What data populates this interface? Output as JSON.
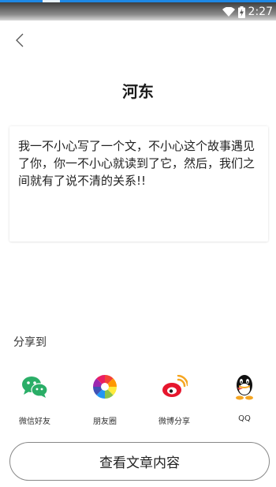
{
  "status_bar": {
    "time": "2:27"
  },
  "header": {
    "title": "河东"
  },
  "content": {
    "text": "我一不小心写了一个文，不小心这个故事遇见了你，你一不小心就读到了它，然后，我们之间就有了说不清的关系!!"
  },
  "share": {
    "label": "分享到",
    "items": [
      {
        "label": "微信好友",
        "icon": "wechat-icon"
      },
      {
        "label": "朋友圈",
        "icon": "moments-icon"
      },
      {
        "label": "微博分享",
        "icon": "weibo-icon"
      },
      {
        "label": "QQ",
        "icon": "qq-icon"
      }
    ]
  },
  "footer": {
    "view_button_label": "查看文章内容"
  },
  "colors": {
    "wechat": "#2aae67",
    "weibo_red": "#e6162d",
    "status_accent": "#1e88e5"
  }
}
